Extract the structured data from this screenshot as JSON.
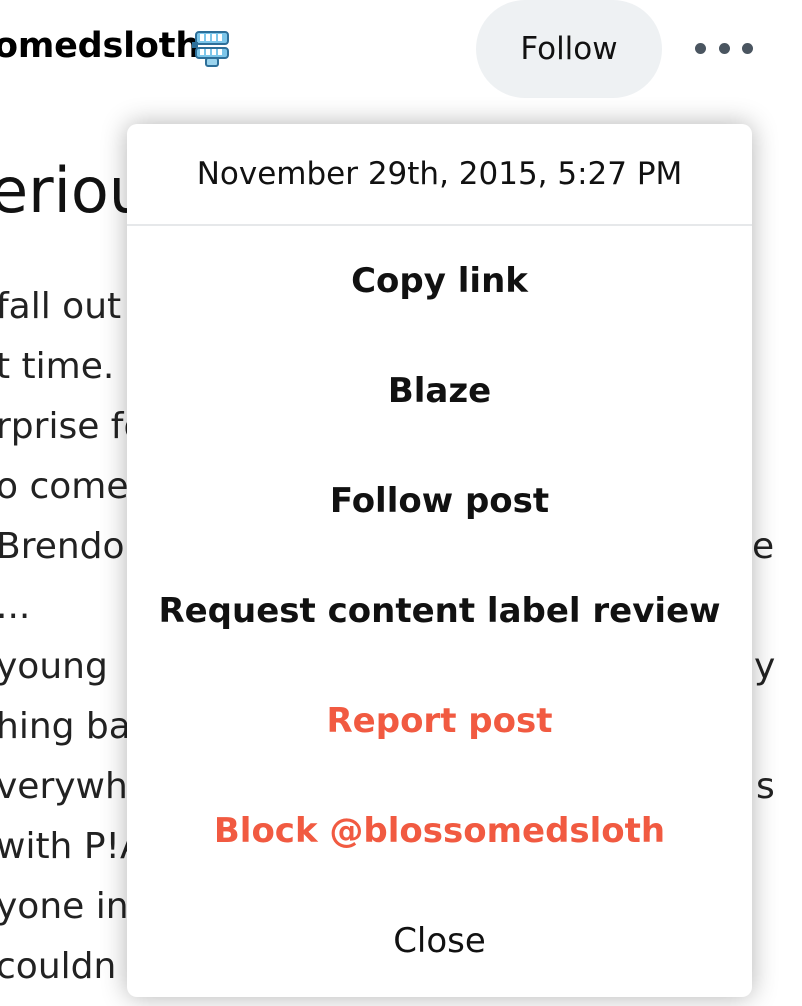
{
  "header": {
    "username_fragment": "omedsloth",
    "follow_label": "Follow",
    "badge_icon": "wind-up-teeth-icon",
    "more_icon": "more-dots-icon"
  },
  "post": {
    "title_fragment": "eriou",
    "lines": [
      "fall out",
      "t time. F",
      "rprise fo",
      "o come",
      " Brendo",
      "...",
      " young",
      "hing bar",
      "verywhe",
      "with P!A",
      "yone in t",
      " couldn"
    ],
    "right_fragments": [
      "e",
      "y",
      "s"
    ]
  },
  "menu": {
    "date": "November 29th, 2015, 5:27 PM",
    "items": [
      "Copy link",
      "Blaze",
      "Follow post",
      "Request content label review",
      "Report post",
      "Block @blossomedsloth",
      "Close"
    ]
  },
  "colors": {
    "danger": "#f15a41",
    "follow_bg": "#eef1f3"
  }
}
